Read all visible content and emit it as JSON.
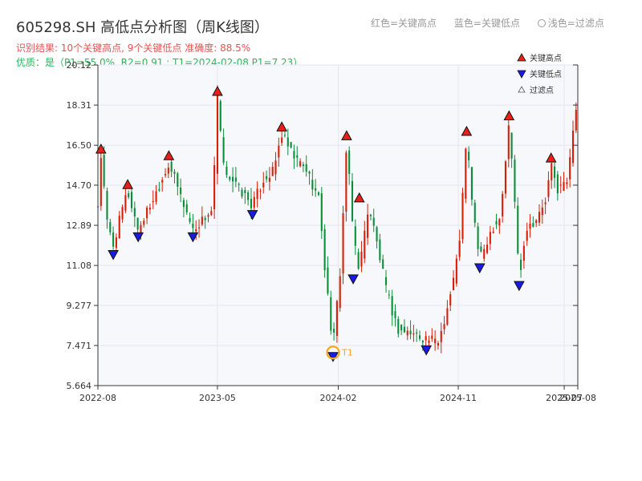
{
  "header": {
    "title": "605298.SH 高低点分析图（周K线图）",
    "subtitle": "识别结果: 10个关键高点, 9个关键低点  准确度: 88.5%",
    "quality": "优质：是（P1=55.0%, R2=0.91 ; T1=2024-02-08 P1=7.23）"
  },
  "top_legend": {
    "red": "红色=关键高点",
    "blue": "蓝色=关键低点",
    "light": "浅色=过滤点"
  },
  "colors": {
    "up": "#d81e06",
    "down": "#0b8e3a",
    "high_marker": "#e8201a",
    "low_marker": "#1a1ae8",
    "t1_ring": "#f5a623",
    "plot_bg": "#f6f8fb",
    "grid": "#e3e6ec"
  },
  "chart_data": {
    "type": "candlestick",
    "ylim": [
      5.664,
      20.12
    ],
    "y_ticks": [
      "5.664",
      "7.471",
      "9.277",
      "11.08",
      "12.89",
      "14.70",
      "16.50",
      "18.31",
      "20.12"
    ],
    "x_tick_labels": [
      "2022-08",
      "2023-05",
      "2024-02",
      "2024-11",
      "2025-07",
      "2025-08"
    ],
    "x_tick_dates": [
      "2022-08-01",
      "2023-05-01",
      "2024-02-01",
      "2024-11-01",
      "2025-07-01",
      "2025-08-01"
    ],
    "x_range": [
      "2022-08-01",
      "2025-08-01"
    ],
    "legend": [
      {
        "label": "关键高点",
        "type": "high"
      },
      {
        "label": "关键低点",
        "type": "low"
      },
      {
        "label": "过滤点",
        "type": "filtered"
      }
    ],
    "anchors": [
      [
        "2022-08-01",
        13.8
      ],
      [
        "2022-08-08",
        16.0
      ],
      [
        "2022-08-22",
        13.0
      ],
      [
        "2022-09-05",
        12.0
      ],
      [
        "2022-10-01",
        14.0
      ],
      [
        "2022-10-08",
        14.4
      ],
      [
        "2022-11-01",
        12.7
      ],
      [
        "2022-12-10",
        14.3
      ],
      [
        "2023-01-10",
        15.7
      ],
      [
        "2023-02-10",
        14.0
      ],
      [
        "2023-03-06",
        12.7
      ],
      [
        "2023-04-20",
        13.6
      ],
      [
        "2023-05-01",
        18.6
      ],
      [
        "2023-05-15",
        15.5
      ],
      [
        "2023-06-20",
        14.5
      ],
      [
        "2023-07-20",
        13.8
      ],
      [
        "2023-08-15",
        15.0
      ],
      [
        "2023-09-05",
        15.3
      ],
      [
        "2023-09-25",
        17.0
      ],
      [
        "2023-10-20",
        16.0
      ],
      [
        "2023-11-20",
        15.4
      ],
      [
        "2023-12-20",
        14.0
      ],
      [
        "2024-01-01",
        11.0
      ],
      [
        "2024-01-20",
        7.4
      ],
      [
        "2024-02-06",
        11.0
      ],
      [
        "2024-02-20",
        16.6
      ],
      [
        "2024-03-06",
        12.5
      ],
      [
        "2024-03-20",
        10.9
      ],
      [
        "2024-04-10",
        13.8
      ],
      [
        "2024-04-25",
        12.5
      ],
      [
        "2024-05-20",
        10.0
      ],
      [
        "2024-06-15",
        8.2
      ],
      [
        "2024-07-20",
        8.0
      ],
      [
        "2024-08-20",
        7.8
      ],
      [
        "2024-09-15",
        7.6
      ],
      [
        "2024-10-05",
        9.0
      ],
      [
        "2024-10-25",
        10.8
      ],
      [
        "2024-11-05",
        12.5
      ],
      [
        "2024-11-20",
        16.8
      ],
      [
        "2024-12-05",
        13.5
      ],
      [
        "2024-12-20",
        11.3
      ],
      [
        "2025-01-15",
        12.7
      ],
      [
        "2025-02-05",
        13.3
      ],
      [
        "2025-02-25",
        17.5
      ],
      [
        "2025-03-10",
        14.0
      ],
      [
        "2025-03-20",
        10.5
      ],
      [
        "2025-04-05",
        12.8
      ],
      [
        "2025-05-01",
        13.2
      ],
      [
        "2025-05-20",
        14.0
      ],
      [
        "2025-06-01",
        15.6
      ],
      [
        "2025-06-15",
        14.5
      ],
      [
        "2025-07-10",
        14.9
      ],
      [
        "2025-07-25",
        18.3
      ],
      [
        "2025-08-01",
        18.0
      ]
    ],
    "key_highs": [
      {
        "date": "2022-08-08",
        "value": 16.0
      },
      {
        "date": "2022-10-08",
        "value": 14.4
      },
      {
        "date": "2023-01-10",
        "value": 15.7
      },
      {
        "date": "2023-05-01",
        "value": 18.6
      },
      {
        "date": "2023-09-25",
        "value": 17.0
      },
      {
        "date": "2024-02-20",
        "value": 16.6
      },
      {
        "date": "2024-03-20",
        "value": 13.8
      },
      {
        "date": "2024-11-20",
        "value": 16.8
      },
      {
        "date": "2025-02-25",
        "value": 17.5
      },
      {
        "date": "2025-06-01",
        "value": 15.6
      }
    ],
    "key_lows": [
      {
        "date": "2022-09-05",
        "value": 11.9
      },
      {
        "date": "2022-11-01",
        "value": 12.7
      },
      {
        "date": "2023-03-06",
        "value": 12.7
      },
      {
        "date": "2023-07-20",
        "value": 13.7
      },
      {
        "date": "2024-01-20",
        "value": 7.3
      },
      {
        "date": "2024-03-06",
        "value": 10.8
      },
      {
        "date": "2024-08-20",
        "value": 7.6
      },
      {
        "date": "2024-12-20",
        "value": 11.3
      },
      {
        "date": "2025-03-20",
        "value": 10.5
      }
    ],
    "t1": {
      "label": "T1",
      "date": "2024-01-20",
      "value": 7.3
    }
  }
}
